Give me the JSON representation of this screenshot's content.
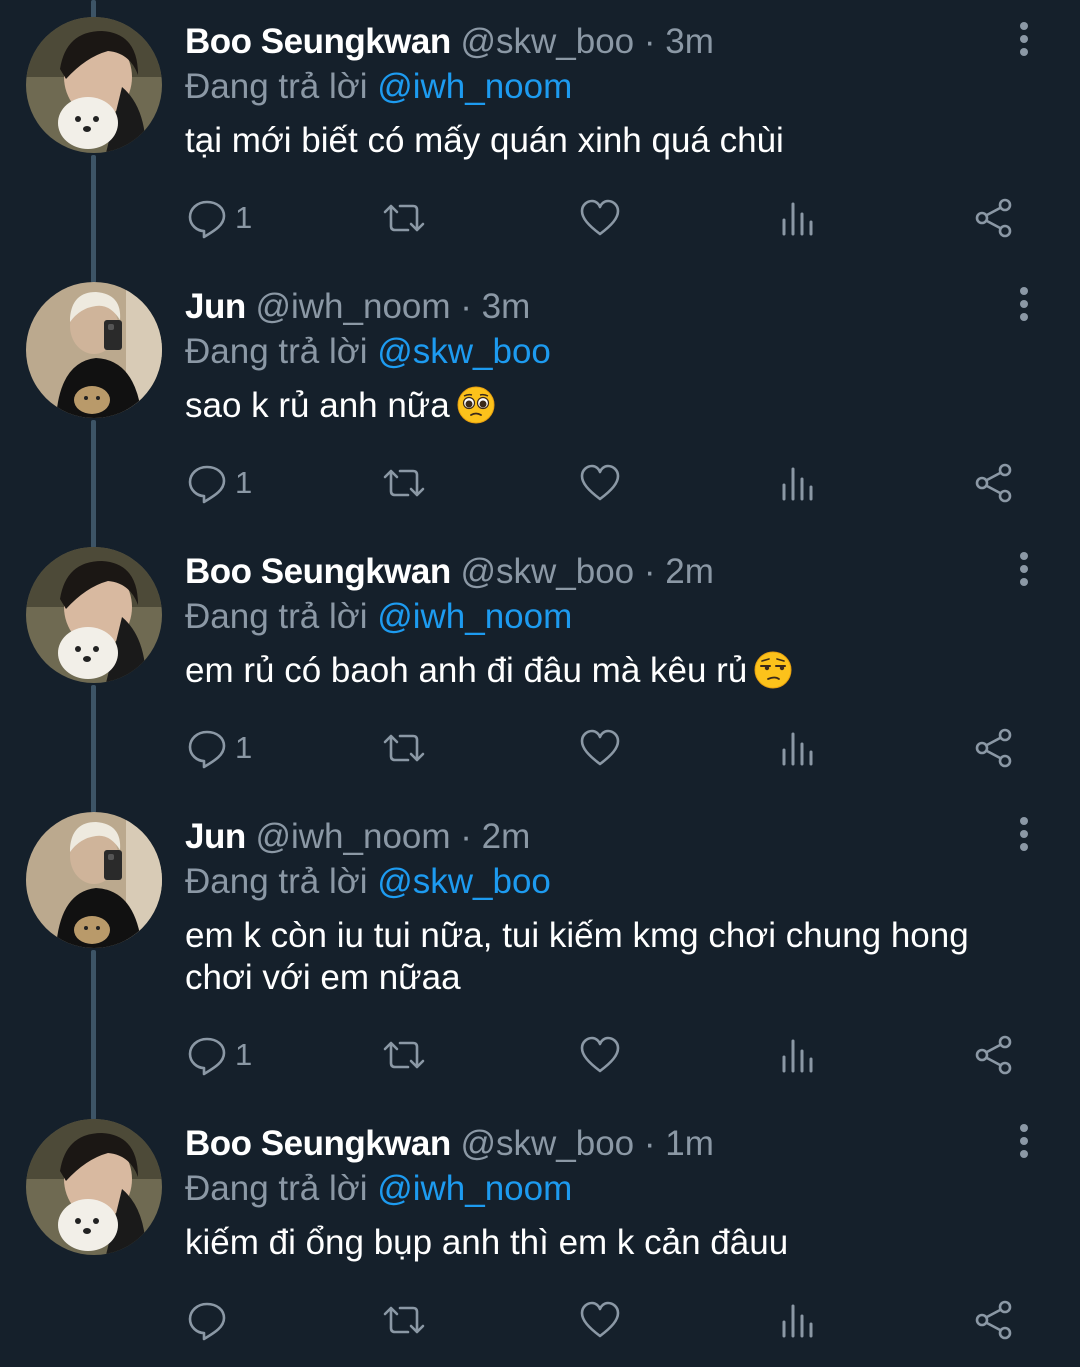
{
  "colors": {
    "background": "#15202b",
    "text_primary": "#ffffff",
    "text_secondary": "#8b98a5",
    "mention": "#1d9bf0",
    "thread_line": "#3d5466"
  },
  "replying_prefix": "Đang trả lời",
  "tweets": [
    {
      "display_name": "Boo Seungkwan",
      "handle": "@skw_boo",
      "dot": "·",
      "time": "3m",
      "reply_to": "@iwh_noom",
      "text": "tại mới biết có mấy quán xinh quá chùi",
      "emoji": "",
      "avatar": "boo-avatar",
      "reply_count": "1"
    },
    {
      "display_name": "Jun",
      "handle": "@iwh_noom",
      "dot": "·",
      "time": "3m",
      "reply_to": "@skw_boo",
      "text": "sao k rủ anh nữa",
      "emoji": "pleading-face",
      "avatar": "jun-avatar",
      "reply_count": "1"
    },
    {
      "display_name": "Boo Seungkwan",
      "handle": "@skw_boo",
      "dot": "·",
      "time": "2m",
      "reply_to": "@iwh_noom",
      "text": "em rủ có baoh anh đi đâu mà kêu rủ",
      "emoji": "unamused-face",
      "avatar": "boo-avatar",
      "reply_count": "1"
    },
    {
      "display_name": "Jun",
      "handle": "@iwh_noom",
      "dot": "·",
      "time": "2m",
      "reply_to": "@skw_boo",
      "text": "em k còn iu tui nữa, tui kiếm kmg chơi chung hong chơi với em nữaa",
      "emoji": "",
      "avatar": "jun-avatar",
      "reply_count": "1"
    },
    {
      "display_name": "Boo Seungkwan",
      "handle": "@skw_boo",
      "dot": "·",
      "time": "1m",
      "reply_to": "@iwh_noom",
      "text": "kiếm đi ổng bụp anh thì em k cản đâuu",
      "emoji": "",
      "avatar": "boo-avatar",
      "reply_count": ""
    }
  ]
}
